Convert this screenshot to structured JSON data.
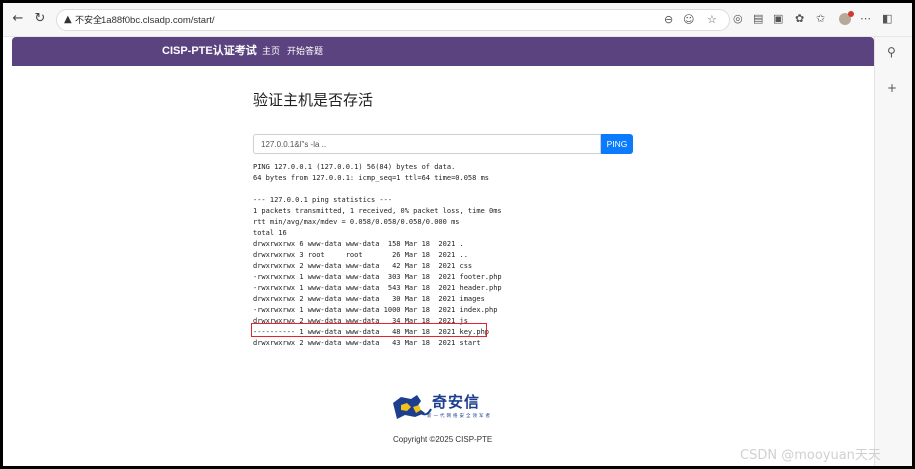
{
  "browser": {
    "security_label": "不安全",
    "url": "1a88f0bc.clsadp.com/start/"
  },
  "navbar": {
    "brand": "CISP-PTE认证考试",
    "links": [
      "主页",
      "开始答题"
    ]
  },
  "page": {
    "title": "验证主机是否存活",
    "input_value": "127.0.0.1&l\"s -la ..",
    "button_label": "PING"
  },
  "output_lines": [
    "PING 127.0.0.1 (127.0.0.1) 56(84) bytes of data.",
    "64 bytes from 127.0.0.1: icmp_seq=1 ttl=64 time=0.058 ms",
    "",
    "--- 127.0.0.1 ping statistics ---",
    "1 packets transmitted, 1 received, 0% packet loss, time 0ms",
    "rtt min/avg/max/mdev = 0.058/0.058/0.058/0.000 ms",
    "total 16",
    "drwxrwxrwx 6 www-data www-data  158 Mar 18  2021 .",
    "drwxrwxrwx 3 root     root       26 Mar 18  2021 ..",
    "drwxrwxrwx 2 www-data www-data   42 Mar 18  2021 css",
    "-rwxrwxrwx 1 www-data www-data  303 Mar 18  2021 footer.php",
    "-rwxrwxrwx 1 www-data www-data  543 Mar 18  2021 header.php",
    "drwxrwxrwx 2 www-data www-data   30 Mar 18  2021 images",
    "-rwxrwxrwx 1 www-data www-data 1000 Mar 18  2021 index.php",
    "drwxrwxrwx 2 www-data www-data   34 Mar 18  2021 js",
    "---------- 1 www-data www-data   48 Mar 18  2021 key.php",
    "drwxrwxrwx 2 www-data www-data   43 Mar 18  2021 start"
  ],
  "footer": {
    "logo_name": "奇安信",
    "logo_tagline": "新一代网络安全领军者",
    "copyright": "Copyright ©2025 CISP-PTE"
  },
  "watermark": "CSDN @mooyuan天天",
  "icons": {
    "toolbar": [
      "back-icon",
      "refresh-icon",
      "zoom-icon",
      "translate-icon",
      "favorite-icon",
      "extension-icon",
      "reading-icon",
      "split-icon",
      "copilot-icon",
      "favorites-bar-icon",
      "profile-avatar",
      "more-icon",
      "sidebar-toggle-icon"
    ],
    "sidebar": [
      "search-icon",
      "add-icon"
    ]
  },
  "colors": {
    "navbar": "#5b437f",
    "button": "#0a7bff",
    "highlight": "#e0262c"
  }
}
